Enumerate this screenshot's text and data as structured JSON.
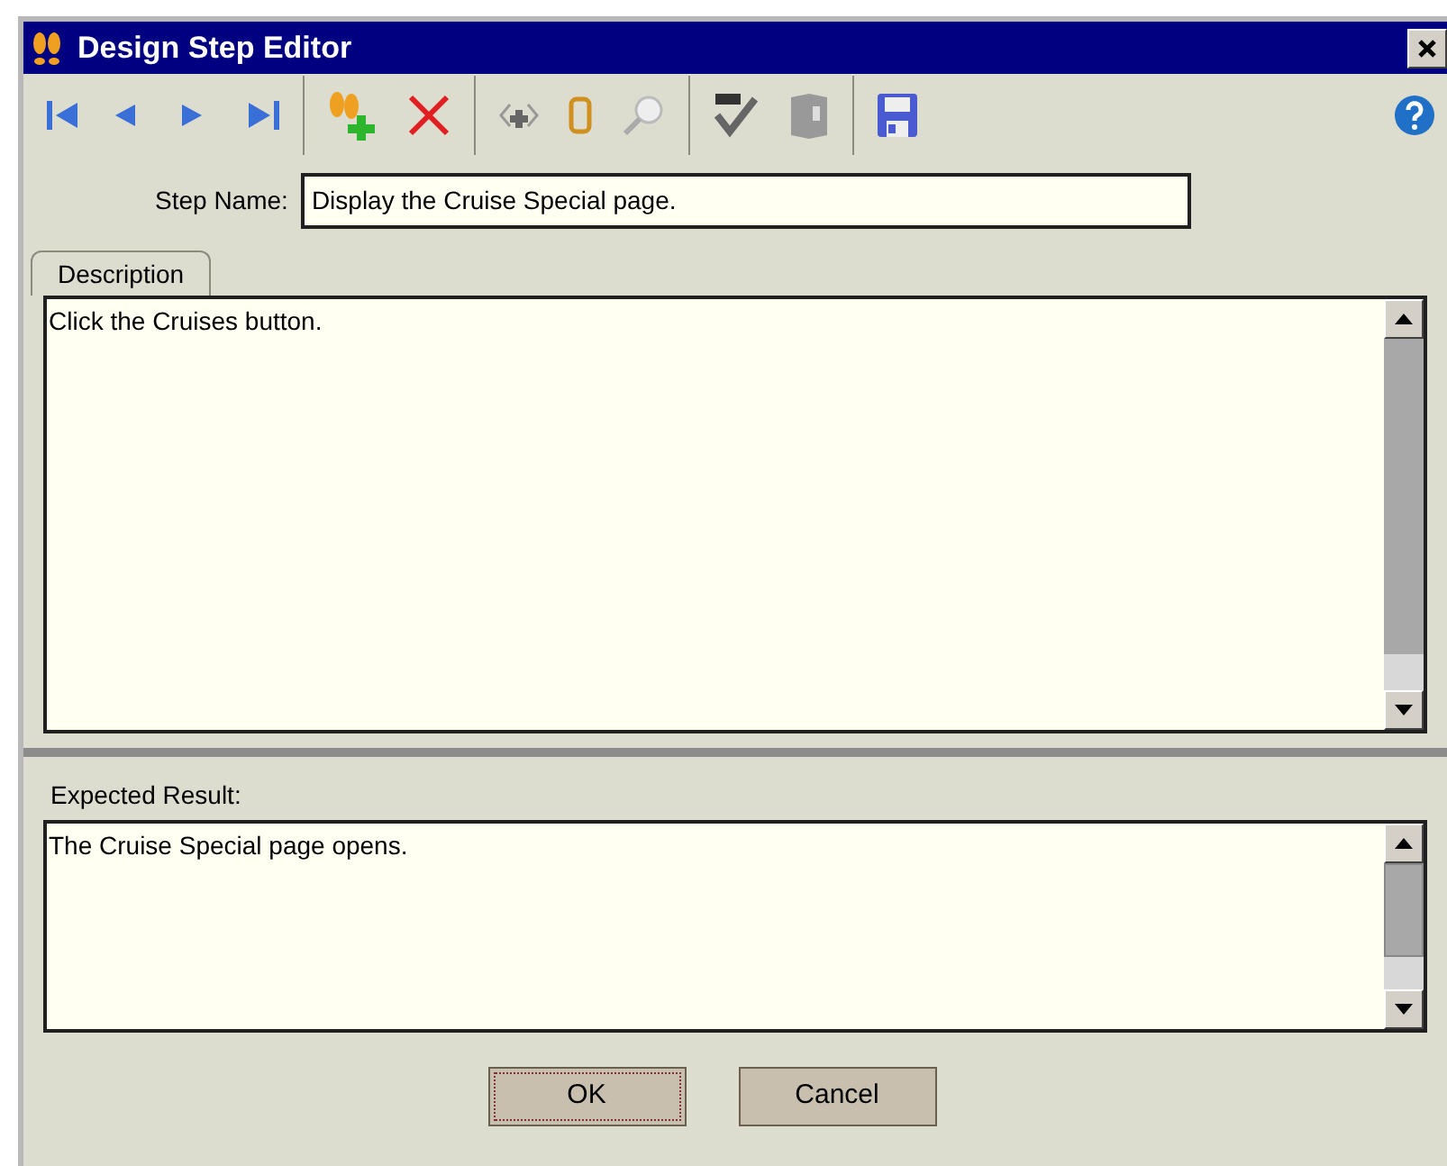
{
  "window": {
    "title": "Design Step Editor"
  },
  "step_name": {
    "label": "Step Name:",
    "value": "Display the Cruise Special page."
  },
  "tabs": [
    {
      "label": "Description",
      "selected": true
    }
  ],
  "description": {
    "text": "Click the Cruises button."
  },
  "expected_result": {
    "label": "Expected Result:",
    "text": "The Cruise Special page opens."
  },
  "buttons": [
    {
      "label": "OK",
      "focused": true
    },
    {
      "label": "Cancel",
      "focused": false
    }
  ]
}
